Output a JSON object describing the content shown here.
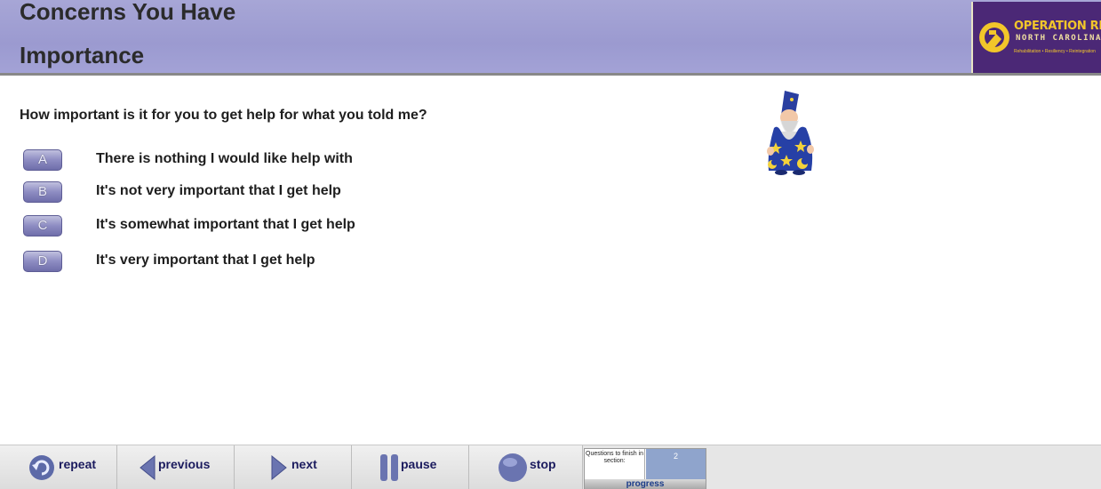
{
  "header": {
    "title": "Concerns You Have",
    "subtitle": "Importance",
    "logo": {
      "line1": "OPERATION REENTRY",
      "line2": "NORTH CAROLINA",
      "line3": "Rehabilitation • Resiliency • Reintegration"
    }
  },
  "question": {
    "text": "How important is it for you to get help for what you told me?",
    "options": [
      {
        "letter": "A",
        "text": "There is nothing I would like help with"
      },
      {
        "letter": "B",
        "text": "It's not very important that I get help"
      },
      {
        "letter": "C",
        "text": "It's somewhat important that I get help"
      },
      {
        "letter": "D",
        "text": "It's very important that I get help"
      }
    ]
  },
  "toolbar": {
    "repeat": "repeat",
    "previous": "previous",
    "next": "next",
    "pause": "pause",
    "stop": "stop",
    "progress": {
      "label": "Questions to finish in section:",
      "count": "2",
      "bar_label": "progress"
    }
  },
  "colors": {
    "header_bg": "#9b9ad0",
    "logo_bg": "#4b2876",
    "logo_text": "#f2c62a",
    "option_button": "#8d8cc2",
    "progress_count_bg": "#8fa4cc"
  }
}
